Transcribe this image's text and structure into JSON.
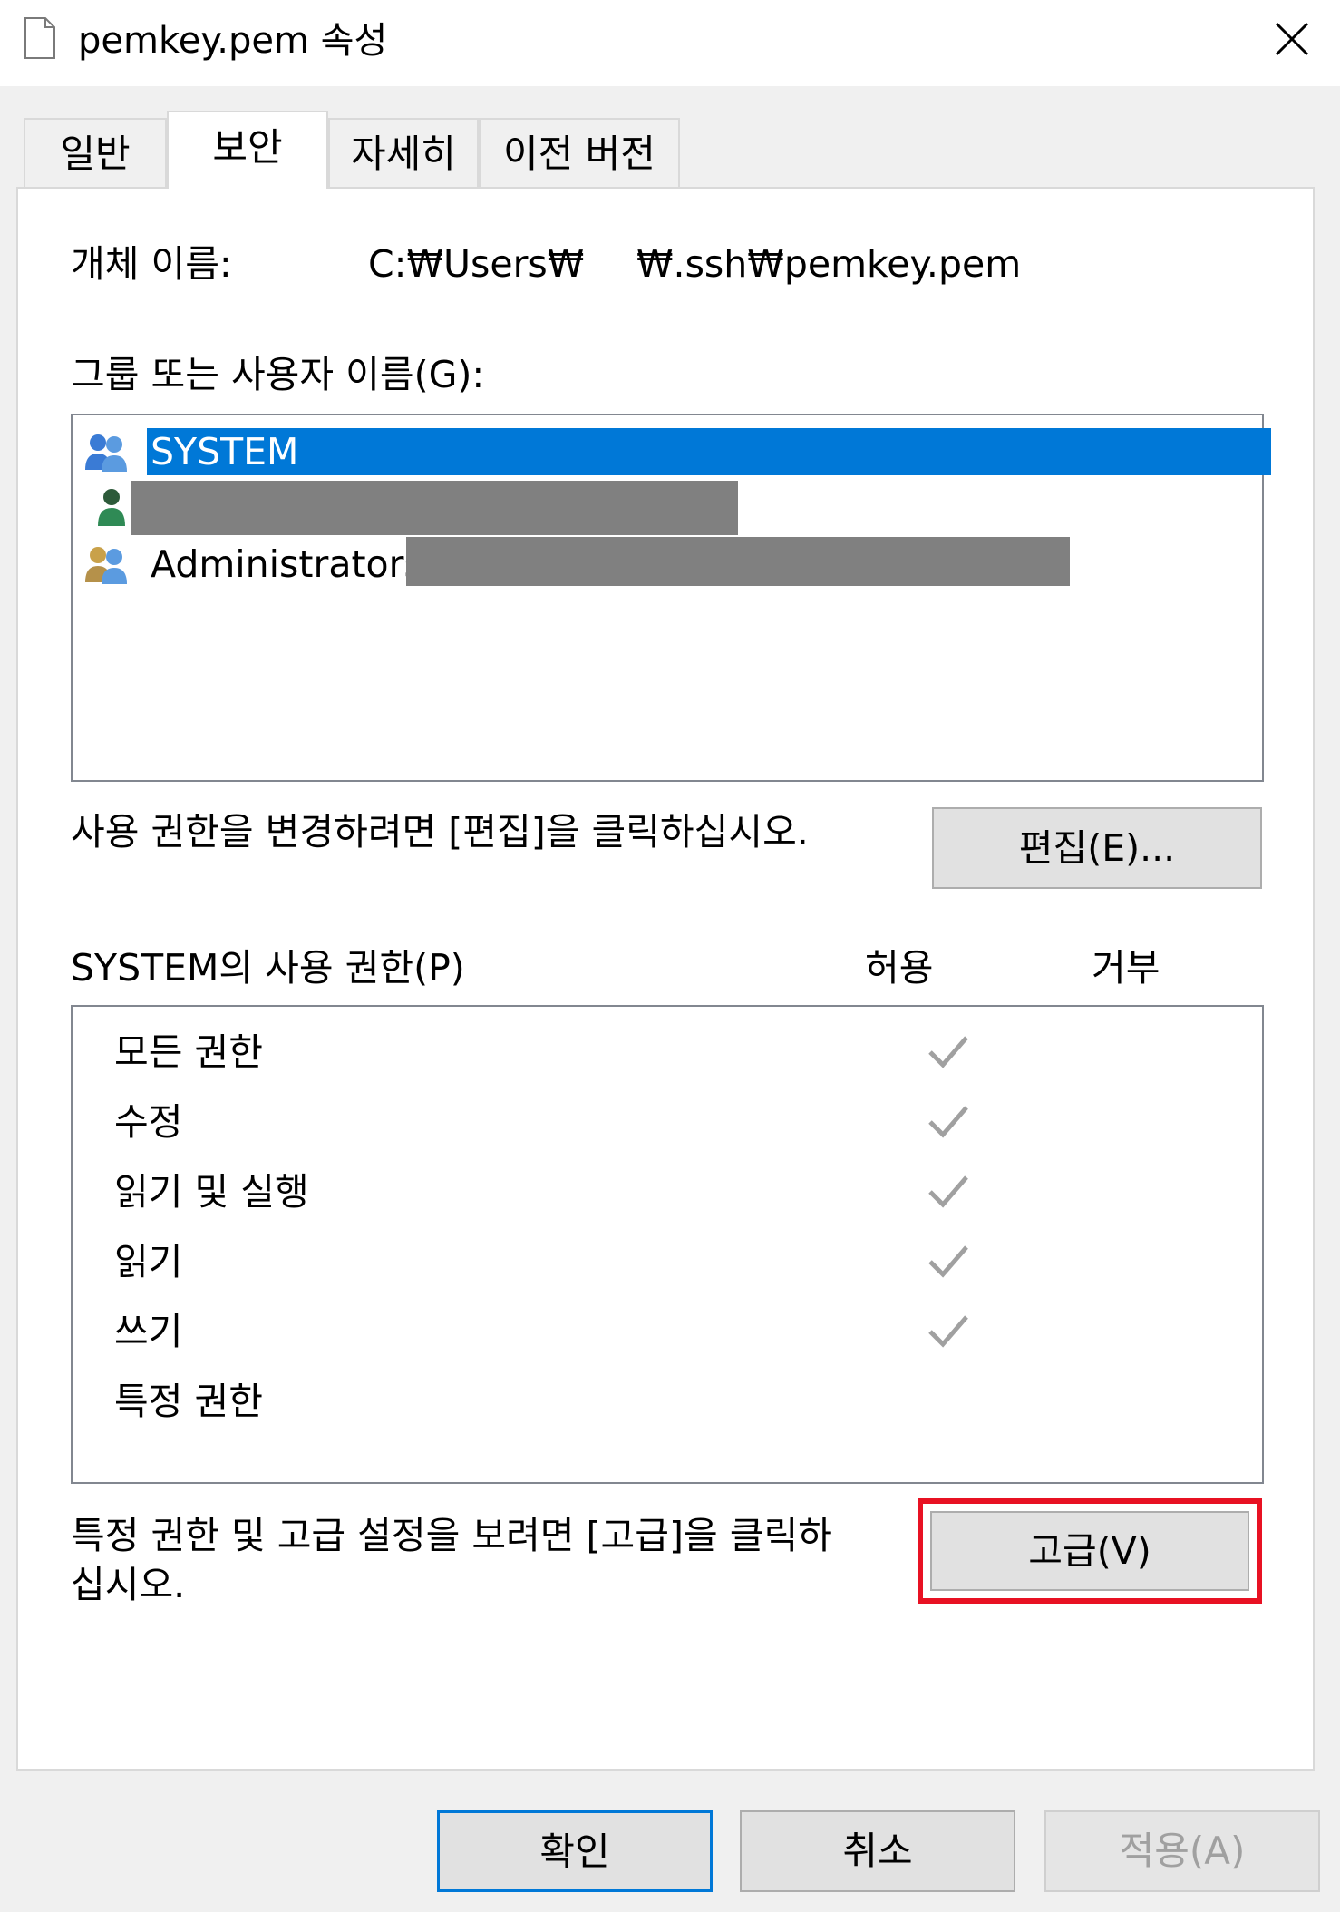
{
  "window": {
    "title": "pemkey.pem 속성",
    "icon": "file-icon",
    "close_icon": "close-icon"
  },
  "tabs": [
    {
      "label": "일반"
    },
    {
      "label": "보안",
      "active": true
    },
    {
      "label": "자세히"
    },
    {
      "label": "이전 버전"
    }
  ],
  "security": {
    "object_name_label": "개체 이름:",
    "object_path_part1": "C:₩Users₩",
    "object_path_part2": "₩.ssh₩pemkey.pem",
    "group_label": "그룹 또는 사용자 이름(G):",
    "users": [
      {
        "name": "SYSTEM",
        "icon": "group-users-icon",
        "selected": true
      },
      {
        "name": "",
        "icon": "user-icon",
        "redacted": true
      },
      {
        "name": "Administrators",
        "icon": "group-users-icon",
        "redacted_suffix": true
      }
    ],
    "edit_hint": "사용 권한을 변경하려면 [편집]을 클릭하십시오.",
    "edit_button": "편집(E)...",
    "permissions_label": "SYSTEM의 사용 권한(P)",
    "allow_header": "허용",
    "deny_header": "거부",
    "permissions": [
      {
        "name": "모든 권한",
        "allow": true,
        "deny": false
      },
      {
        "name": "수정",
        "allow": true,
        "deny": false
      },
      {
        "name": "읽기 및 실행",
        "allow": true,
        "deny": false
      },
      {
        "name": "읽기",
        "allow": true,
        "deny": false
      },
      {
        "name": "쓰기",
        "allow": true,
        "deny": false
      },
      {
        "name": "특정 권한",
        "allow": false,
        "deny": false
      }
    ],
    "advanced_hint_line1": "특정 권한 및 고급 설정을 보려면 [고급]을 클릭하",
    "advanced_hint_line2": "십시오.",
    "advanced_button": "고급(V)"
  },
  "buttons": {
    "ok": "확인",
    "cancel": "취소",
    "apply": "적용(A)"
  },
  "colors": {
    "selection": "#0078d7",
    "highlight_box": "#e81123",
    "check": "#a0a0a0",
    "disabled_text": "#a0a0a0"
  }
}
